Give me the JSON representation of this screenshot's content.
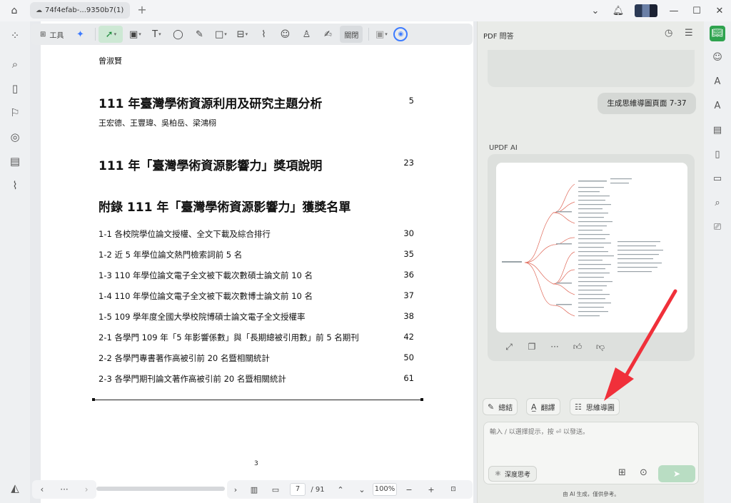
{
  "titlebar": {
    "tab_label": "74f4efab-...9350b7(1)",
    "new_tab": "+"
  },
  "toolbar": {
    "tools_label": "工具",
    "close_label": "關閉"
  },
  "document": {
    "top_author": "曾淑賢",
    "sections": [
      {
        "title": "111 年臺灣學術資源利用及研究主題分析",
        "page": "5",
        "authors": "王宏德、王豐瑋、吳柏岳、梁鴻栩"
      },
      {
        "title": "111 年「臺灣學術資源影響力」獎項說明",
        "page": "23"
      },
      {
        "title": "附錄 111 年「臺灣學術資源影響力」獲獎名單"
      }
    ],
    "entries": [
      {
        "text": "1-1 各校院學位論文授權、全文下載及綜合排行",
        "page": "30"
      },
      {
        "text": "1-2  近 5 年學位論文熱門檢索詞前 5 名",
        "page": "35"
      },
      {
        "text": "1-3  110 年學位論文電子全文被下載次數碩士論文前 10 名",
        "page": "36"
      },
      {
        "text": "1-4  110 年學位論文電子全文被下載次數博士論文前 10 名",
        "page": "37"
      },
      {
        "text": "1-5  109 學年度全國大學校院博碩士論文電子全文授權率",
        "page": "38"
      },
      {
        "text": "2-1  各學門 109 年「5 年影響係數」與「長期總被引用數」前 5 名期刊",
        "page": "42"
      },
      {
        "text": "2-2 各學門專書著作高被引前 20 名暨相關統計",
        "page": "50"
      },
      {
        "text": "2-3 各學門期刊論文著作高被引前 20 名暨相關統計",
        "page": "61"
      }
    ],
    "page_number": "3"
  },
  "nav": {
    "current_page": "7",
    "total_pages": "/ 91",
    "zoom": "100%"
  },
  "panel": {
    "title": "PDF 問答",
    "user_message": "生成思維導圖頁面 7-37",
    "ai_label": "UPDF AI",
    "quick_actions": [
      "總結",
      "翻譯",
      "思維導圖"
    ],
    "input_placeholder": "輸入 / 以選擇提示，按 ⏎ 以發送。",
    "deep_think": "深度思考",
    "footnote": "由 AI 生成，僅供參考。"
  },
  "colors": {
    "accent": "#2fa34f",
    "arrow": "#f0303a",
    "mindmap_lines": "#e06a5a"
  }
}
